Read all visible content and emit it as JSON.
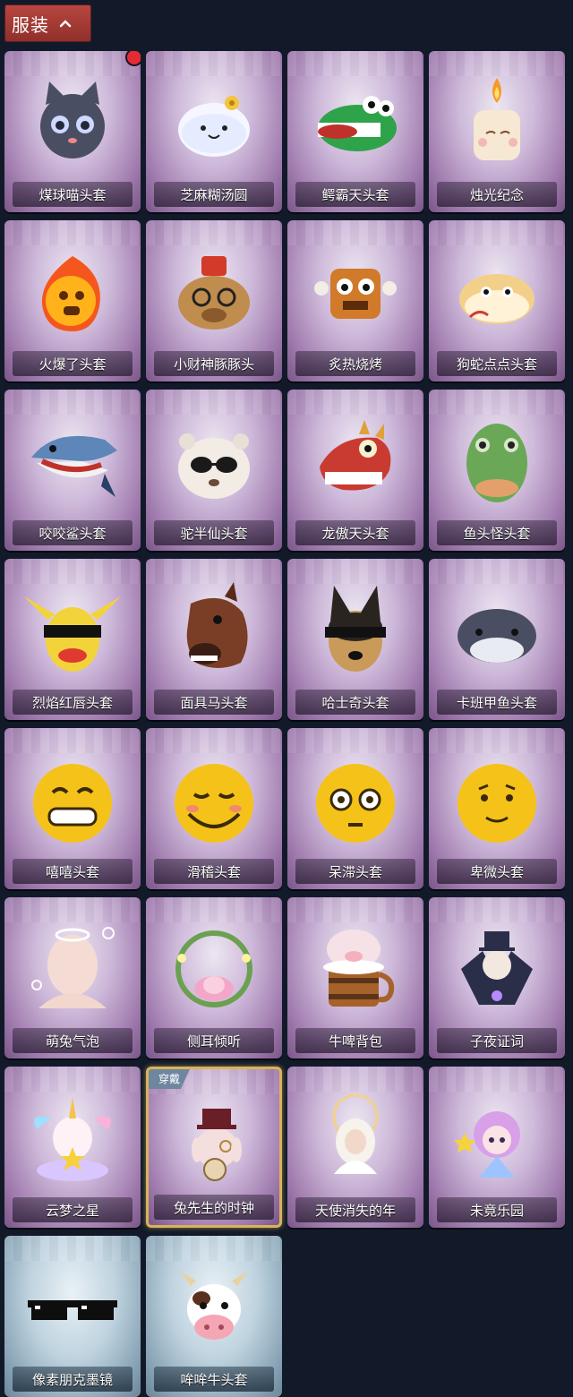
{
  "section": {
    "title": "服装",
    "toggle_icon": "chevron-up-icon"
  },
  "items": [
    {
      "name": "煤球喵头套",
      "style": "purple",
      "icon": "cat",
      "badge": "new"
    },
    {
      "name": "芝麻糊汤圆",
      "style": "purple",
      "icon": "dumpling"
    },
    {
      "name": "鳄霸天头套",
      "style": "purple",
      "icon": "croc"
    },
    {
      "name": "烛光纪念",
      "style": "purple",
      "icon": "candle"
    },
    {
      "name": "火爆了头套",
      "style": "purple",
      "icon": "fire"
    },
    {
      "name": "小财神豚豚头",
      "style": "purple",
      "icon": "capybara"
    },
    {
      "name": "炙热烧烤",
      "style": "purple",
      "icon": "meat"
    },
    {
      "name": "狗蛇点点头套",
      "style": "purple",
      "icon": "snake"
    },
    {
      "name": "咬咬鲨头套",
      "style": "purple",
      "icon": "shark"
    },
    {
      "name": "驼半仙头套",
      "style": "purple",
      "icon": "alpaca"
    },
    {
      "name": "龙傲天头套",
      "style": "purple",
      "icon": "dragon"
    },
    {
      "name": "鱼头怪头套",
      "style": "purple",
      "icon": "fishhead"
    },
    {
      "name": "烈焰红唇头套",
      "style": "purple",
      "icon": "pikachu"
    },
    {
      "name": "面具马头套",
      "style": "purple",
      "icon": "horse"
    },
    {
      "name": "哈士奇头套",
      "style": "purple",
      "icon": "dog"
    },
    {
      "name": "卡班甲鱼头套",
      "style": "purple",
      "icon": "whale"
    },
    {
      "name": "嘻嘻头套",
      "style": "purple",
      "icon": "grin"
    },
    {
      "name": "滑稽头套",
      "style": "purple",
      "icon": "smirk"
    },
    {
      "name": "呆滞头套",
      "style": "purple",
      "icon": "dazed"
    },
    {
      "name": "卑微头套",
      "style": "purple",
      "icon": "humble"
    },
    {
      "name": "萌兔气泡",
      "style": "purple",
      "icon": "bubble"
    },
    {
      "name": "侧耳倾听",
      "style": "purple",
      "icon": "wreath"
    },
    {
      "name": "牛啤背包",
      "style": "purple",
      "icon": "beer"
    },
    {
      "name": "子夜证词",
      "style": "purple",
      "icon": "crow"
    },
    {
      "name": "云梦之星",
      "style": "purple",
      "icon": "unicorn"
    },
    {
      "name": "兔先生的时钟",
      "style": "purple",
      "icon": "rabbit",
      "equipped": true,
      "equipped_label": "穿戴"
    },
    {
      "name": "天使消失的年",
      "style": "purple",
      "icon": "angel"
    },
    {
      "name": "未竟乐园",
      "style": "purple",
      "icon": "doll"
    },
    {
      "name": "像素朋克墨镜",
      "style": "blue",
      "icon": "sunglasses"
    },
    {
      "name": "哞哞牛头套",
      "style": "blue",
      "icon": "cow"
    }
  ],
  "colors": {
    "background": "#121a2a",
    "accent_red": "#e52c36",
    "header_red": "#a83a35",
    "equipped_gold": "#d9b35a"
  }
}
